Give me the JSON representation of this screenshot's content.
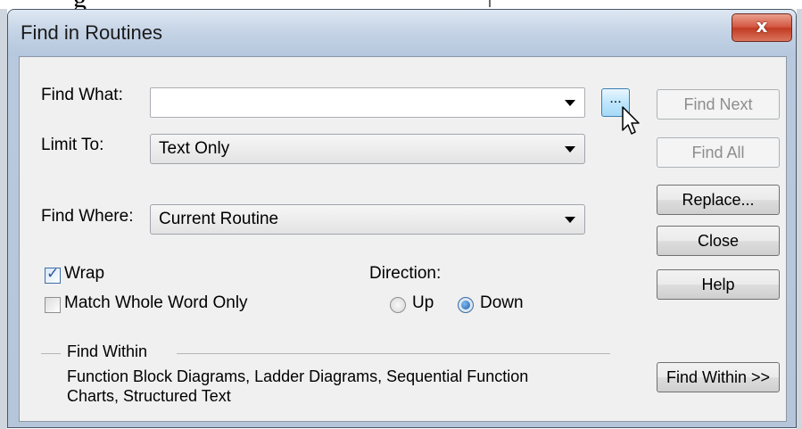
{
  "background_text": "g",
  "window": {
    "title": "Find in Routines",
    "close_glyph": "x"
  },
  "find_what": {
    "label": "Find What:",
    "value": "",
    "browse_label": "..."
  },
  "limit_to": {
    "label": "Limit To:",
    "value": "Text Only"
  },
  "find_where": {
    "label": "Find Where:",
    "value": "Current Routine"
  },
  "options": {
    "wrap_label": "Wrap",
    "wrap_checked": true,
    "whole_word_label": "Match Whole Word Only",
    "whole_word_checked": false,
    "checkmark": "✓"
  },
  "direction": {
    "label": "Direction:",
    "up_label": "Up",
    "down_label": "Down",
    "selected": "Down"
  },
  "buttons": {
    "find_next": "Find Next",
    "find_all": "Find All",
    "replace": "Replace...",
    "close": "Close",
    "help": "Help",
    "find_within": "Find Within >>"
  },
  "find_within": {
    "legend": "Find Within",
    "line1": "Function Block Diagrams, Ladder Diagrams, Sequential Function",
    "line2": "Charts, Structured Text"
  },
  "colors": {
    "titlebar": "#c6d4e6",
    "close_button": "#c23b22",
    "dialog_face": "#f0f0f0",
    "browse_hover": "#bee6fd"
  }
}
